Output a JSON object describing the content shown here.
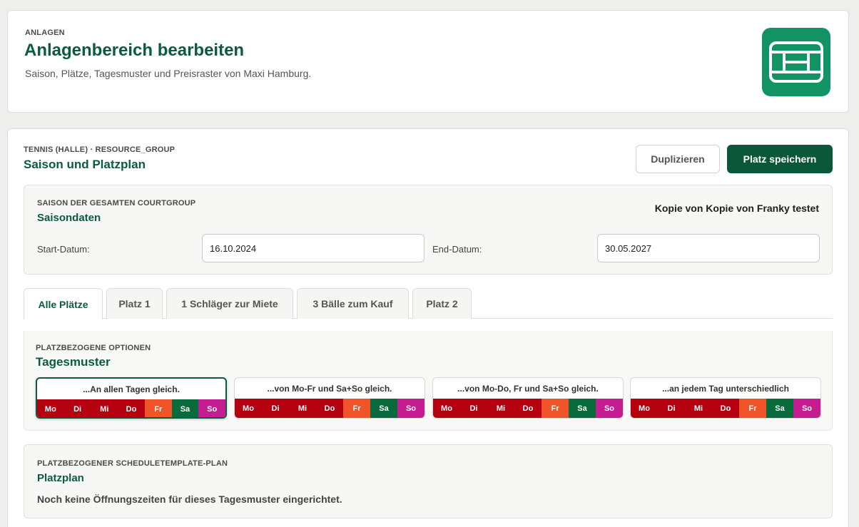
{
  "header": {
    "eyebrow": "ANLAGEN",
    "title": "Anlagenbereich bearbeiten",
    "subtitle": "Saison, Plätze, Tagesmuster und Preisraster von Maxi Hamburg.",
    "logo_icon": "tennis-court-icon"
  },
  "section": {
    "eyebrow": "TENNIS (HALLE) · RESOURCE_GROUP",
    "title": "Saison und Platzplan",
    "duplicate_label": "Duplizieren",
    "save_label": "Platz speichern"
  },
  "season": {
    "eyebrow": "SAISON DER GESAMTEN COURTGROUP",
    "title": "Saisondaten",
    "name": "Kopie von Kopie von Franky testet",
    "start_label": "Start-Datum:",
    "start_value": "16.10.2024",
    "end_label": "End-Datum:",
    "end_value": "30.05.2027"
  },
  "tabs": [
    {
      "label": "Alle Plätze",
      "active": true
    },
    {
      "label": "Platz 1"
    },
    {
      "label": "1 Schläger zur Miete"
    },
    {
      "label": "3 Bälle zum Kauf"
    },
    {
      "label": "Platz 2"
    }
  ],
  "patterns": {
    "eyebrow": "PLATZBEZOGENE OPTIONEN",
    "title": "Tagesmuster",
    "days": [
      "Mo",
      "Di",
      "Mi",
      "Do",
      "Fr",
      "Sa",
      "So"
    ],
    "options": [
      {
        "label": "...An allen Tagen gleich.",
        "selected": true,
        "colors": [
          "#b5000f",
          "#b5000f",
          "#b5000f",
          "#b5000f",
          "#f2542a",
          "#086b3b",
          "#c51c92"
        ]
      },
      {
        "label": "...von Mo-Fr und Sa+So gleich.",
        "colors": [
          "#b5000f",
          "#b5000f",
          "#b5000f",
          "#b5000f",
          "#f2542a",
          "#086b3b",
          "#c51c92"
        ]
      },
      {
        "label": "...von Mo-Do, Fr und Sa+So gleich.",
        "colors": [
          "#b5000f",
          "#b5000f",
          "#b5000f",
          "#b5000f",
          "#f2542a",
          "#086b3b",
          "#c51c92"
        ]
      },
      {
        "label": "...an jedem Tag unterschiedlich",
        "colors": [
          "#b5000f",
          "#b5000f",
          "#b5000f",
          "#b5000f",
          "#f2542a",
          "#086b3b",
          "#c51c92"
        ]
      }
    ]
  },
  "plan": {
    "eyebrow": "PLATZBEZOGENER SCHEDULETEMPLATE-PLAN",
    "title": "Platzplan",
    "empty_text": "Noch keine Öffnungszeiten für dieses Tagesmuster eingerichtet."
  }
}
